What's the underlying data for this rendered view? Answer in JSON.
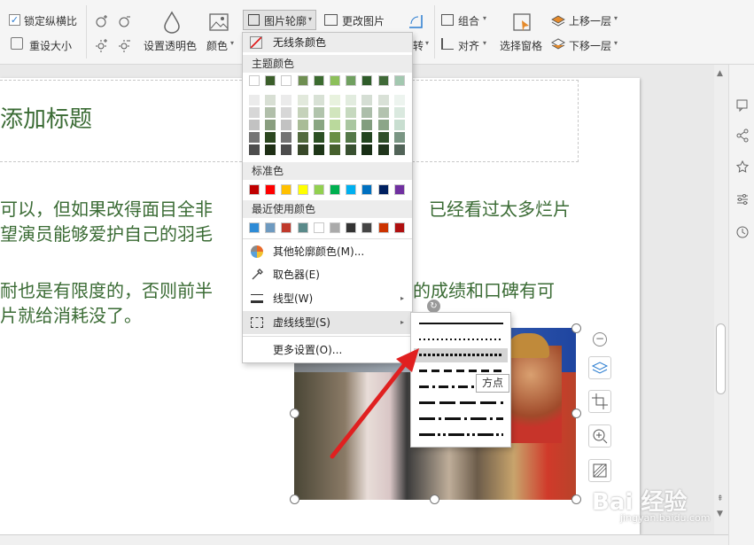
{
  "ribbon": {
    "lock_ratio_label": "锁定纵横比",
    "reset_size_label": "重设大小",
    "set_transparent_label": "设置透明色",
    "color_label": "颜色",
    "picture_outline_label": "图片轮廓",
    "change_picture_label": "更改图片",
    "rotate_label": "转",
    "combine_label": "组合",
    "align_label": "对齐",
    "selection_pane_label": "选择窗格",
    "bring_forward_label": "上移一层",
    "send_backward_label": "下移一层"
  },
  "slide": {
    "title": "添加标题",
    "line1": "可以，但如果改得面目全非",
    "line1_right": "已经看过太多烂片",
    "line2": "望演员能够爱护自己的羽毛",
    "line3": "耐也是有限度的，否则前半",
    "line3_right": "的成绩和口碑有可",
    "line4": "片就给消耗没了。"
  },
  "outline_menu": {
    "no_line": "无线条颜色",
    "theme_colors": "主题颜色",
    "standard_colors": "标准色",
    "recent_colors": "最近使用颜色",
    "more_colors": "其他轮廓颜色(M)...",
    "eyedropper": "取色器(E)",
    "line_type": "线型(W)",
    "dash_type": "虚线线型(S)",
    "more_settings": "更多设置(O)...",
    "theme_top": [
      "#ffffff",
      "#3b5e2a",
      "#ffffff",
      "#6f8f52",
      "#3b6b2f",
      "#8cbf5a",
      "#70a060",
      "#2f5c2a",
      "#406a38",
      "#a3c8b0"
    ],
    "standard": [
      "#c00000",
      "#ff0000",
      "#ffc000",
      "#ffff00",
      "#92d050",
      "#00b050",
      "#00b0f0",
      "#0070c0",
      "#002060",
      "#7030a0"
    ],
    "recent": [
      "#2e8bd6",
      "#6e9ac0",
      "#c0392b",
      "#5a8a8a",
      "#ffffff",
      "#aaaaaa",
      "#333333",
      "#444444",
      "#cc3300",
      "#b01010"
    ]
  },
  "tooltip": {
    "text": "方点"
  },
  "watermark": {
    "brand": "Bai 经验",
    "url": "jingyan.baidu.com"
  },
  "colors": {
    "title_green": "#3a6b34",
    "accent_red": "#e02020"
  }
}
